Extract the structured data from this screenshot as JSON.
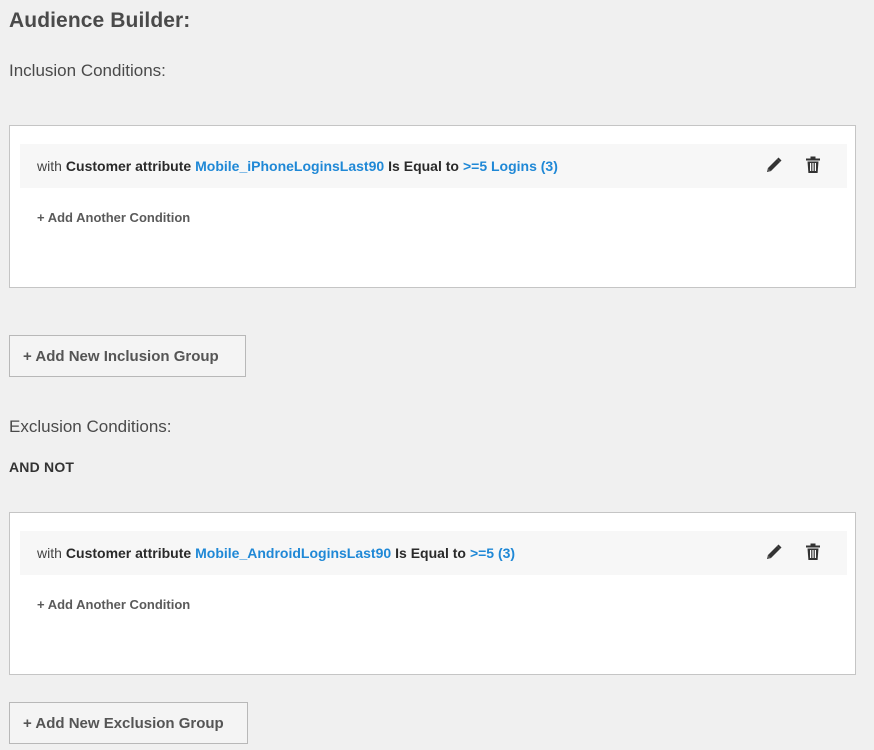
{
  "page": {
    "title": "Audience Builder:"
  },
  "inclusion": {
    "label": "Inclusion Conditions:",
    "condition": {
      "prefix": "with",
      "entity": "Customer attribute",
      "attribute": "Mobile_iPhoneLoginsLast90",
      "operator": "Is Equal to",
      "value": ">=5 Logins (3)"
    },
    "add_condition_label": "+ Add Another Condition",
    "add_group_label": "+ Add New Inclusion Group"
  },
  "exclusion": {
    "label": "Exclusion Conditions:",
    "and_not": "AND NOT",
    "condition": {
      "prefix": "with",
      "entity": "Customer attribute",
      "attribute": "Mobile_AndroidLoginsLast90",
      "operator": "Is Equal to",
      "value": ">=5 (3)"
    },
    "add_condition_label": "+ Add Another Condition",
    "add_group_label": "+ Add New Exclusion Group"
  },
  "icons": {
    "edit": "pencil-icon",
    "delete": "trash-icon"
  },
  "colors": {
    "link": "#1f88d6",
    "background": "#f0f0f0",
    "panel": "#ffffff",
    "row": "#f7f7f7"
  }
}
